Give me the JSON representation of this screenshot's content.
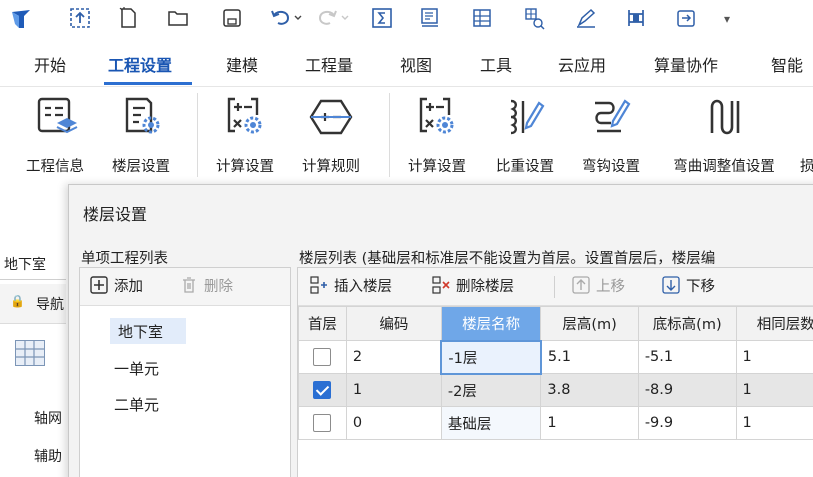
{
  "ribbon_tabs": [
    {
      "label": "开始",
      "active": false
    },
    {
      "label": "工程设置",
      "active": true
    },
    {
      "label": "建模",
      "active": false
    },
    {
      "label": "工程量",
      "active": false
    },
    {
      "label": "视图",
      "active": false
    },
    {
      "label": "工具",
      "active": false
    },
    {
      "label": "云应用",
      "active": false
    },
    {
      "label": "算量协作",
      "active": false
    },
    {
      "label": "智能",
      "active": false
    }
  ],
  "quick_access": [
    "app-logo-icon",
    "upload-icon",
    "new-file-icon",
    "open-folder-icon",
    "save-icon",
    "undo-icon",
    "redo-icon",
    "formula-icon",
    "report-icon",
    "grid-icon",
    "search-grid-icon",
    "pen-icon",
    "column-icon",
    "export-icon",
    "more-icon"
  ],
  "ribbon_buttons": [
    {
      "label": "工程信息",
      "icon": "project-info-icon"
    },
    {
      "label": "楼层设置",
      "icon": "floor-settings-icon"
    },
    {
      "label": "计算设置",
      "icon": "calc-settings-icon"
    },
    {
      "label": "计算规则",
      "icon": "calc-rules-icon"
    },
    {
      "label": "计算设置",
      "icon": "calc-settings-icon"
    },
    {
      "label": "比重设置",
      "icon": "density-settings-icon"
    },
    {
      "label": "弯钩设置",
      "icon": "hook-settings-icon"
    },
    {
      "label": "弯曲调整值设置",
      "icon": "bend-adjust-icon"
    },
    {
      "label": "损",
      "icon": "truncated-icon"
    }
  ],
  "background_panel": {
    "tab_label": "地下室",
    "nav_label": "导航",
    "item_1": "轴网",
    "item_2": "辅助"
  },
  "dialog": {
    "title": "楼层设置",
    "left_panel": {
      "title": "单项工程列表",
      "add_label": "添加",
      "delete_label": "删除",
      "items": [
        "地下室",
        "一单元",
        "二单元"
      ],
      "selected_index": 0
    },
    "right_panel": {
      "title": "楼层列表 (基础层和标准层不能设置为首层。设置首层后，楼层编",
      "toolbar": {
        "insert_label": "插入楼层",
        "delete_label": "删除楼层",
        "up_label": "上移",
        "down_label": "下移"
      },
      "columns": [
        "首层",
        "编码",
        "楼层名称",
        "层高(m)",
        "底标高(m)",
        "相同层数"
      ],
      "highlighted_column": 2,
      "rows": [
        {
          "first": false,
          "code": "2",
          "name": "-1层",
          "height": "5.1",
          "bottom": "-5.1",
          "same": "1"
        },
        {
          "first": true,
          "code": "1",
          "name": "-2层",
          "height": "3.8",
          "bottom": "-8.9",
          "same": "1"
        },
        {
          "first": false,
          "code": "0",
          "name": "基础层",
          "height": "1",
          "bottom": "-9.9",
          "same": "1"
        }
      ]
    }
  },
  "colors": {
    "accent": "#2c6fd1",
    "header_highlight": "#6fa7e8",
    "checkbox_on": "#2a6fd3",
    "icon_blue": "#2f5fa8"
  }
}
